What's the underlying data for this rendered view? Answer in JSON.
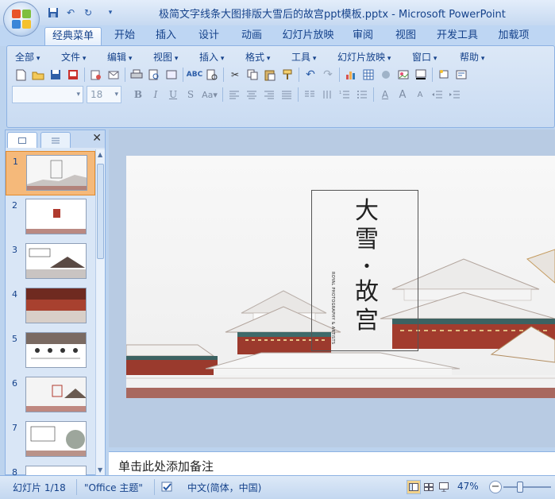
{
  "window": {
    "title": "极简文字线条大图排版大雪后的故宫ppt模板.pptx - Microsoft PowerPoint"
  },
  "ribbon_tabs": [
    "经典菜单",
    "开始",
    "插入",
    "设计",
    "动画",
    "幻灯片放映",
    "审阅",
    "视图",
    "开发工具",
    "加载项"
  ],
  "classic_menu": [
    "全部",
    "文件",
    "编辑",
    "视图",
    "插入",
    "格式",
    "工具",
    "幻灯片放映",
    "窗口",
    "帮助"
  ],
  "font_combo": {
    "name": "",
    "size": "18"
  },
  "slide_panel": {
    "slide_numbers": [
      "1",
      "2",
      "3",
      "4",
      "5",
      "6",
      "7",
      "8"
    ],
    "selected": "1"
  },
  "slide": {
    "title_line1": "大",
    "title_line2": "雪",
    "title_dot": "·",
    "title_line3": "故",
    "title_line4": "宫",
    "vertical_small": "ROYAL PHOTOGRAPHY & ARTISTS"
  },
  "notes": {
    "placeholder": "单击此处添加备注"
  },
  "status": {
    "slide_info": "幻灯片 1/18",
    "theme": "\"Office 主题\"",
    "language": "中文(简体，中国)",
    "zoom": "47%"
  },
  "colors": {
    "accent": "#15428b",
    "selected_thumb": "#f5b97a"
  }
}
